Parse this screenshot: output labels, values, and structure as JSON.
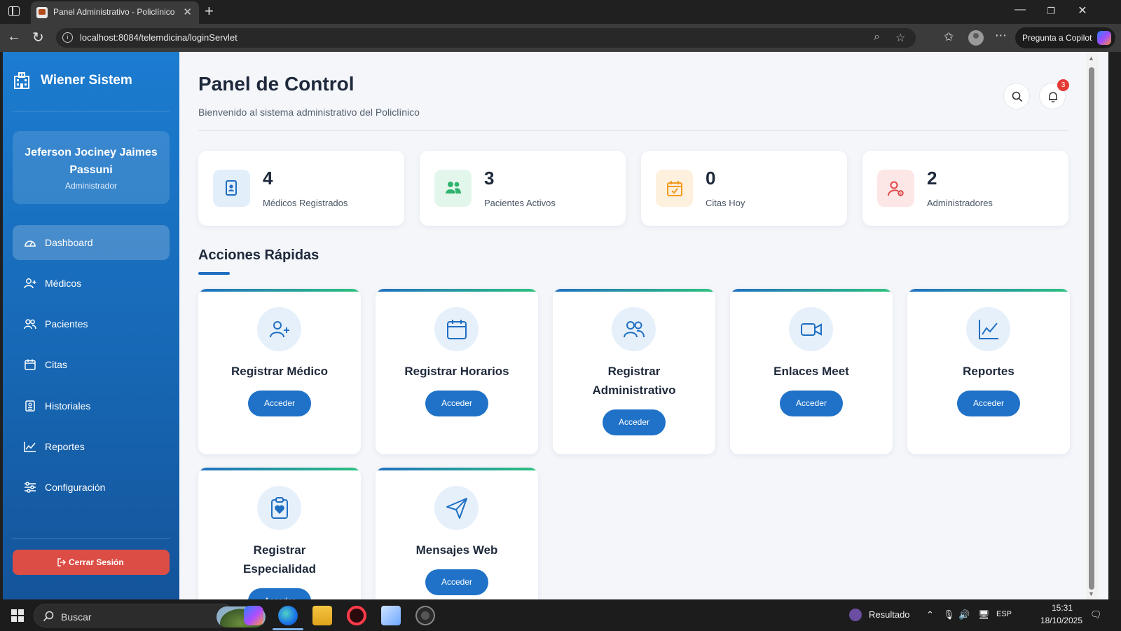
{
  "browser": {
    "tab_title": "Panel Administrativo - Policlínico",
    "url": "localhost:8084/telemdicina/loginServlet",
    "copilot_label": "Pregunta a Copilot"
  },
  "sidebar": {
    "brand": "Wiener Sistem",
    "user_name": "Jeferson Jociney Jaimes Passuni",
    "user_role": "Administrador",
    "items": [
      {
        "label": "Dashboard",
        "icon": "gauge-icon",
        "active": true
      },
      {
        "label": "Médicos",
        "icon": "user-plus-icon"
      },
      {
        "label": "Pacientes",
        "icon": "users-icon"
      },
      {
        "label": "Citas",
        "icon": "calendar-icon"
      },
      {
        "label": "Historiales",
        "icon": "file-medical-icon"
      },
      {
        "label": "Reportes",
        "icon": "chart-line-icon"
      },
      {
        "label": "Configuración",
        "icon": "sliders-icon"
      }
    ],
    "logout_label": "Cerrar Sesión"
  },
  "header": {
    "title": "Panel de Control",
    "subtitle": "Bienvenido al sistema administrativo del Policlínico",
    "notification_count": "3"
  },
  "stats": [
    {
      "value": "4",
      "label": "Médicos Registrados",
      "icon": "id-badge-icon",
      "color": "#1f6fc2",
      "bg": "#e3eefb"
    },
    {
      "value": "3",
      "label": "Pacientes Activos",
      "icon": "users-icon",
      "color": "#2fb36d",
      "bg": "#e3f6ec"
    },
    {
      "value": "0",
      "label": "Citas Hoy",
      "icon": "calendar-check-icon",
      "color": "#f29a1e",
      "bg": "#fdf0dc"
    },
    {
      "value": "2",
      "label": "Administradores",
      "icon": "user-gear-icon",
      "color": "#e0474a",
      "bg": "#fce6e6"
    }
  ],
  "quick_actions": {
    "title": "Acciones Rápidas",
    "button_label": "Acceder",
    "cards": [
      {
        "title": "Registrar Médico",
        "icon": "user-plus-icon"
      },
      {
        "title": "Registrar Horarios",
        "icon": "calendar-icon"
      },
      {
        "title": "Registrar Administrativo",
        "icon": "users-icon"
      },
      {
        "title": "Enlaces Meet",
        "icon": "video-icon"
      },
      {
        "title": "Reportes",
        "icon": "chart-line-icon"
      },
      {
        "title": "Registrar Especialidad",
        "icon": "clipboard-heart-icon"
      },
      {
        "title": "Mensajes Web",
        "icon": "paper-plane-icon"
      }
    ]
  },
  "taskbar": {
    "search_placeholder": "Buscar",
    "weather_label": "Resultado",
    "language": "ESP",
    "time": "15:31",
    "date": "18/10/2025"
  },
  "colors": {
    "sidebar_top": "#1c7cd0",
    "sidebar_bottom": "#14549a",
    "primary_button": "#1f72c7",
    "logout": "#dc4d45",
    "badge": "#e53935"
  }
}
